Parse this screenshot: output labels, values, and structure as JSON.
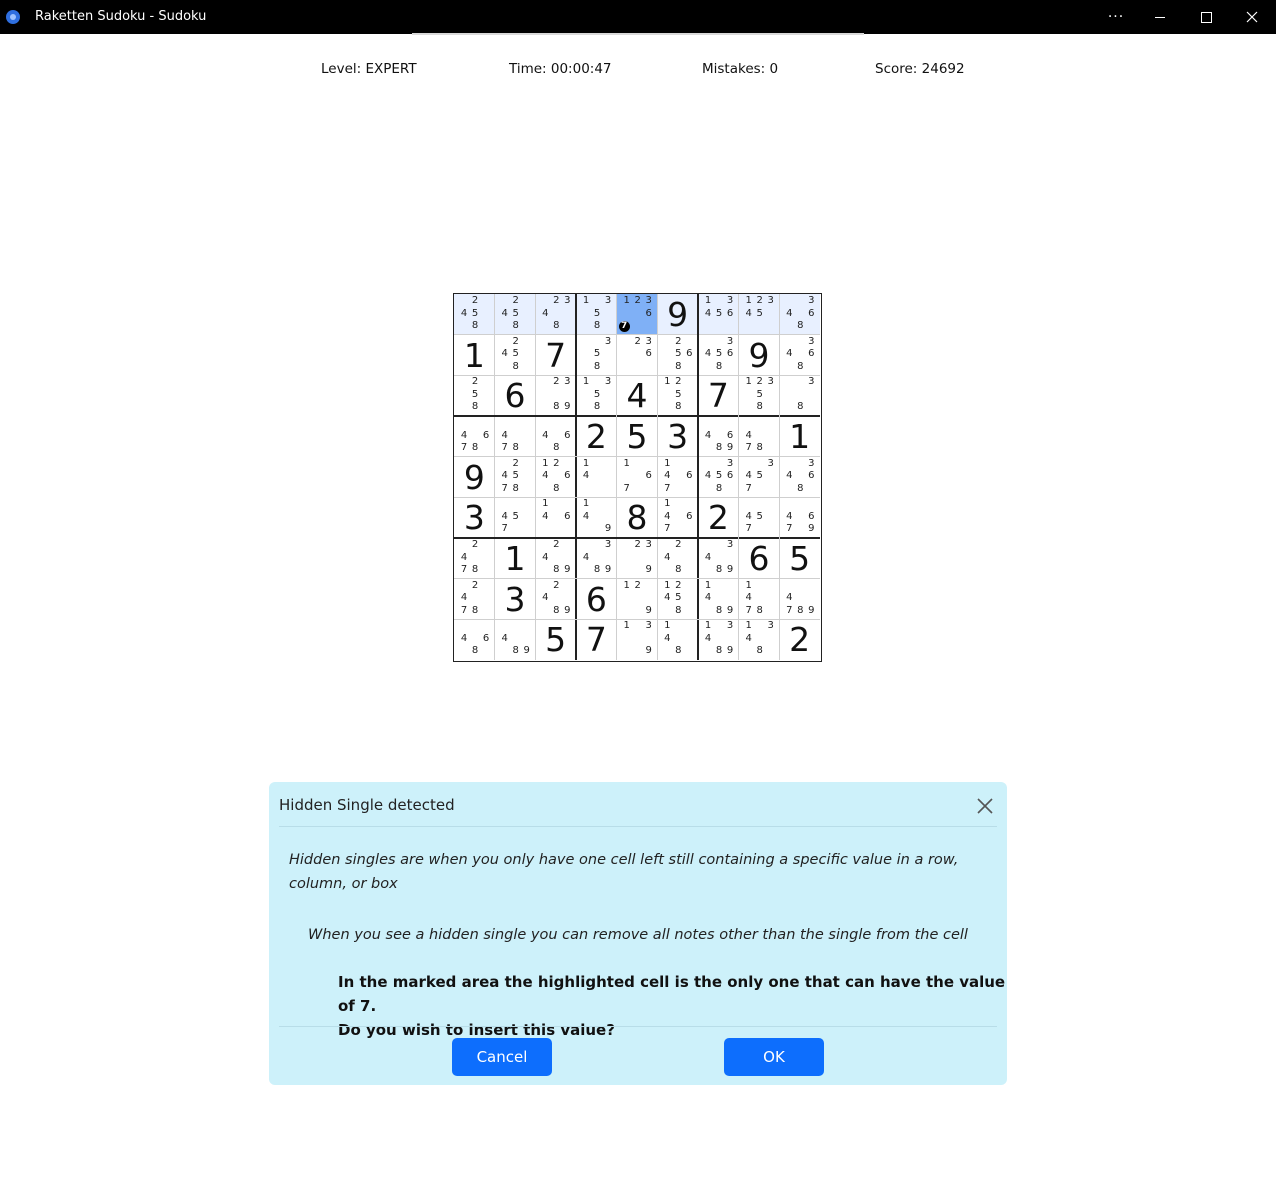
{
  "window": {
    "title": "Raketten Sudoku - Sudoku",
    "more_label": "···"
  },
  "stats": {
    "level": "Level: EXPERT",
    "time": "Time: 00:00:47",
    "mistakes": "Mistakes: 0",
    "score": "Score: 24692"
  },
  "board": {
    "values": [
      [
        0,
        0,
        0,
        0,
        0,
        9,
        0,
        0,
        0
      ],
      [
        1,
        0,
        7,
        0,
        0,
        0,
        0,
        9,
        0
      ],
      [
        0,
        6,
        0,
        0,
        4,
        0,
        7,
        0,
        0
      ],
      [
        0,
        0,
        0,
        2,
        5,
        3,
        0,
        0,
        1
      ],
      [
        9,
        0,
        0,
        0,
        0,
        0,
        0,
        0,
        0
      ],
      [
        3,
        0,
        0,
        0,
        8,
        0,
        2,
        0,
        0
      ],
      [
        0,
        1,
        0,
        0,
        0,
        0,
        0,
        6,
        5
      ],
      [
        0,
        3,
        0,
        6,
        0,
        0,
        0,
        0,
        0
      ],
      [
        0,
        0,
        5,
        7,
        0,
        0,
        0,
        0,
        2
      ]
    ],
    "notes": [
      [
        "2458",
        "2458",
        "2348",
        "1358",
        "1236",
        "",
        "13456",
        "12345",
        "3468"
      ],
      [
        "",
        "2458",
        "",
        "358",
        "236",
        "2568",
        "34568",
        "",
        "3468"
      ],
      [
        "258",
        "",
        "2389",
        "1358",
        "",
        "1258",
        "",
        "12358",
        "38"
      ],
      [
        "4678",
        "478",
        "468",
        "",
        "",
        "",
        "4689",
        "478",
        ""
      ],
      [
        "",
        "24578",
        "12468",
        "14",
        "167",
        "1467",
        "34568",
        "3457",
        "3468"
      ],
      [
        "",
        "457",
        "146",
        "149",
        "",
        "1467",
        "",
        "457",
        "4679"
      ],
      [
        "2478",
        "",
        "2489",
        "3489",
        "239",
        "248",
        "3489",
        "",
        ""
      ],
      [
        "2478",
        "",
        "2489",
        "",
        "129",
        "12458",
        "1489",
        "1478",
        "4789"
      ],
      [
        "468",
        "489",
        "",
        "",
        "139",
        "148",
        "13489",
        "1348",
        ""
      ]
    ],
    "highlighted_row": 0,
    "selected_cell": [
      0,
      4
    ],
    "hint_value": "7"
  },
  "dialog": {
    "title": "Hidden Single detected",
    "paragraph1": "Hidden singles are when you only have one cell left still containing a specific value in a row, column, or box",
    "paragraph2": "When you see a hidden single you can remove all notes other than the single from the cell",
    "bold_line1": "In the marked area the highlighted cell is the only one that can have the value of 7.",
    "bold_line2": "Do you wish to insert this value?",
    "cancel_label": "Cancel",
    "ok_label": "OK"
  },
  "colors": {
    "button": "#0d6efd",
    "dialog_bg": "#cdf1fa",
    "highlight": "#e8f0ff",
    "selected": "#7fb0f6"
  }
}
